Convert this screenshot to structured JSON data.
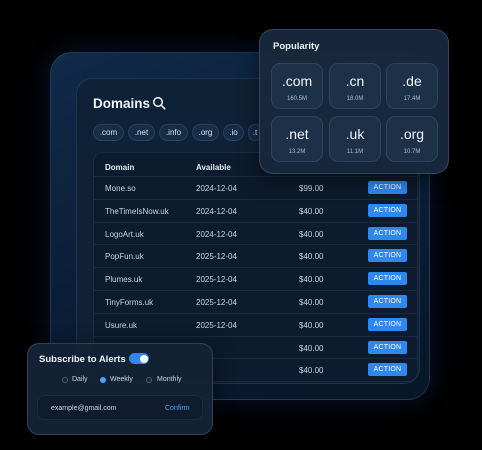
{
  "colors": {
    "accent": "#2f87f0",
    "background": "#000000",
    "panel": "#0f2136"
  },
  "domains": {
    "title": "Domains",
    "search_icon": "search-icon",
    "tld_filters": [
      ".com",
      ".net",
      ".info",
      ".org",
      ".io",
      ".t"
    ],
    "table": {
      "headers": [
        "Domain",
        "Available",
        "",
        ""
      ],
      "rows": [
        {
          "domain": "Mone.so",
          "available": "2024-12-04",
          "price": "$99.00",
          "action": "ACTION"
        },
        {
          "domain": "TheTimeIsNow.uk",
          "available": "2024-12-04",
          "price": "$40.00",
          "action": "ACTION"
        },
        {
          "domain": "LogoArt.uk",
          "available": "2024-12-04",
          "price": "$40.00",
          "action": "ACTION"
        },
        {
          "domain": "PopFun.uk",
          "available": "2025-12-04",
          "price": "$40.00",
          "action": "ACTION"
        },
        {
          "domain": "Plumes.uk",
          "available": "2025-12-04",
          "price": "$40.00",
          "action": "ACTION"
        },
        {
          "domain": "TinyForms.uk",
          "available": "2025-12-04",
          "price": "$40.00",
          "action": "ACTION"
        },
        {
          "domain": "Usure.uk",
          "available": "2025-12-04",
          "price": "$40.00",
          "action": "ACTION"
        },
        {
          "domain": "",
          "available": "",
          "price": "$40.00",
          "action": "ACTION"
        },
        {
          "domain": "",
          "available": "",
          "price": "$40.00",
          "action": "ACTION"
        }
      ]
    }
  },
  "popularity": {
    "title": "Popularity",
    "items": [
      {
        "tld": ".com",
        "count": "160.5M"
      },
      {
        "tld": ".cn",
        "count": "18.0M"
      },
      {
        "tld": ".de",
        "count": "17.4M"
      },
      {
        "tld": ".net",
        "count": "13.2M"
      },
      {
        "tld": ".uk",
        "count": "11.1M"
      },
      {
        "tld": ".org",
        "count": "10.7M"
      }
    ]
  },
  "subscribe": {
    "title": "Subscribe to Alerts",
    "toggle_on": true,
    "frequency_options": [
      "Daily",
      "Weekly",
      "Monthly"
    ],
    "selected_frequency": "Weekly",
    "email_value": "example@gmail.com",
    "confirm_label": "Confirm"
  }
}
